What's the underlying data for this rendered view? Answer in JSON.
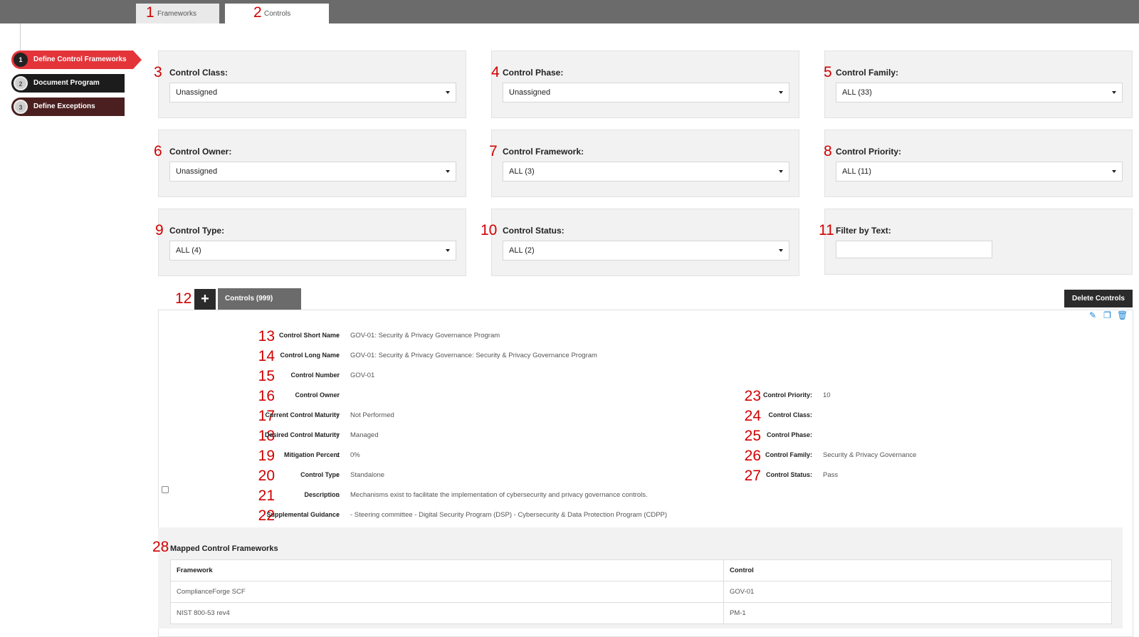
{
  "tabs": [
    {
      "anno": "1",
      "label": "Frameworks"
    },
    {
      "anno": "2",
      "label": "Controls"
    }
  ],
  "steps": [
    {
      "num": "1",
      "label": "Define Control Frameworks"
    },
    {
      "num": "2",
      "label": "Document Program"
    },
    {
      "num": "3",
      "label": "Define Exceptions"
    }
  ],
  "filters": {
    "class": {
      "anno": "3",
      "label": "Control Class:",
      "value": "Unassigned"
    },
    "phase": {
      "anno": "4",
      "label": "Control Phase:",
      "value": "Unassigned"
    },
    "family": {
      "anno": "5",
      "label": "Control Family:",
      "value": "ALL (33)"
    },
    "owner": {
      "anno": "6",
      "label": "Control Owner:",
      "value": "Unassigned"
    },
    "framework": {
      "anno": "7",
      "label": "Control Framework:",
      "value": "ALL (3)"
    },
    "priority": {
      "anno": "8",
      "label": "Control Priority:",
      "value": "ALL (11)"
    },
    "type": {
      "anno": "9",
      "label": "Control Type:",
      "value": "ALL (4)"
    },
    "status": {
      "anno": "10",
      "label": "Control Status:",
      "value": "ALL (2)"
    },
    "text": {
      "anno": "11",
      "label": "Filter by Text:",
      "value": ""
    }
  },
  "toolbar": {
    "anno": "12",
    "add_label": "+",
    "controls_tab": "Controls (999)",
    "delete_label": "Delete Controls"
  },
  "details_left": [
    {
      "anno": "13",
      "key": "Control Short Name",
      "value": "GOV-01: Security & Privacy Governance Program"
    },
    {
      "anno": "14",
      "key": "Control Long Name",
      "value": "GOV-01: Security & Privacy Governance: Security & Privacy Governance Program"
    },
    {
      "anno": "15",
      "key": "Control Number",
      "value": "GOV-01"
    },
    {
      "anno": "16",
      "key": "Control Owner",
      "value": ""
    },
    {
      "anno": "17",
      "key": "Current Control Maturity",
      "value": "Not Performed"
    },
    {
      "anno": "18",
      "key": "Desired Control Maturity",
      "value": "Managed"
    },
    {
      "anno": "19",
      "key": "Mitigation Percent",
      "value": "0%"
    },
    {
      "anno": "20",
      "key": "Control Type",
      "value": "Standalone"
    },
    {
      "anno": "21",
      "key": "Description",
      "value": "Mechanisms exist to facilitate the implementation of cybersecurity and privacy governance controls."
    },
    {
      "anno": "22",
      "key": "Supplemental Guidance",
      "value": "- Steering committee - Digital Security Program (DSP) - Cybersecurity & Data Protection Program (CDPP)"
    }
  ],
  "details_right": [
    {
      "anno": "23",
      "key": "Control Priority",
      "value": "10"
    },
    {
      "anno": "24",
      "key": "Control Class",
      "value": ""
    },
    {
      "anno": "25",
      "key": "Control Phase",
      "value": ""
    },
    {
      "anno": "26",
      "key": "Control Family",
      "value": "Security & Privacy Governance"
    },
    {
      "anno": "27",
      "key": "Control Status",
      "value": "Pass"
    }
  ],
  "mapped": {
    "anno": "28",
    "title": "Mapped Control Frameworks",
    "headers": [
      "Framework",
      "Control"
    ],
    "rows": [
      [
        "ComplianceForge SCF",
        "GOV-01"
      ],
      [
        "NIST 800-53 rev4",
        "PM-1"
      ]
    ]
  },
  "icons": [
    "edit-icon",
    "copy-icon",
    "trash-icon"
  ]
}
